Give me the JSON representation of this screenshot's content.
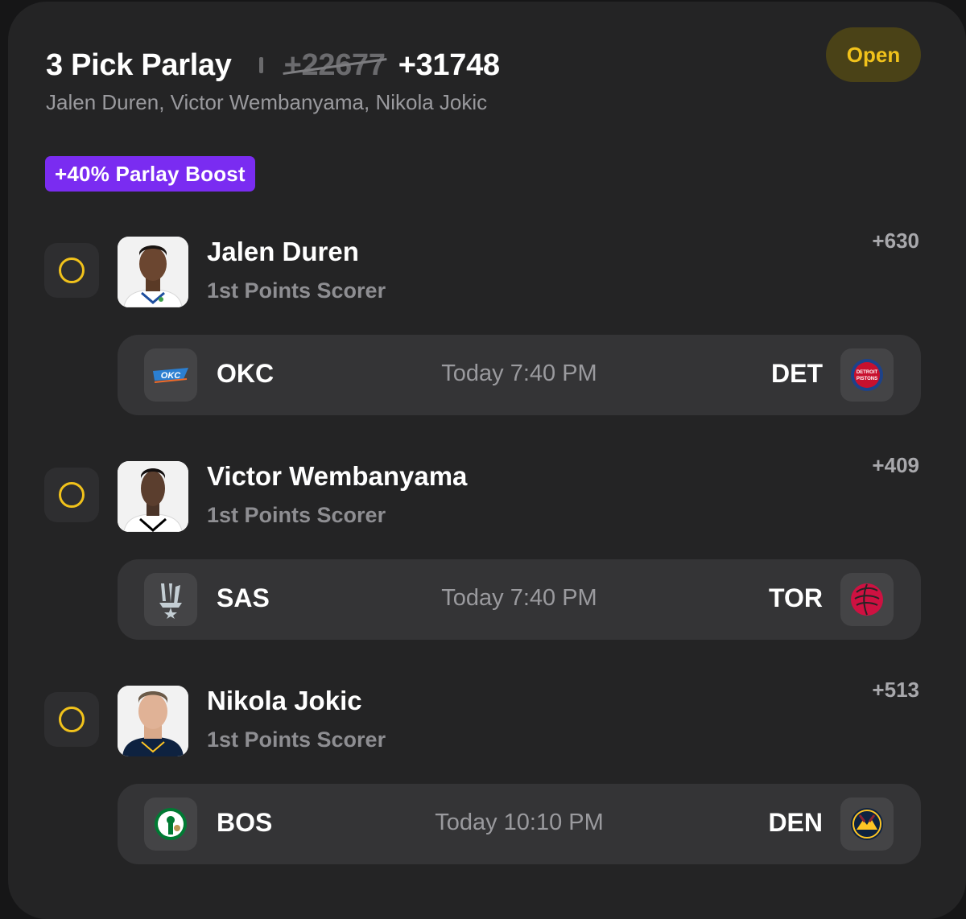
{
  "header": {
    "title": "3 Pick Parlay",
    "old_odds": "+22677",
    "new_odds": "+31748",
    "players_summary": "Jalen Duren, Victor Wembanyama, Nikola Jokic",
    "status": "Open",
    "boost": "+40% Parlay Boost"
  },
  "picks": [
    {
      "player": "Jalen Duren",
      "market": "1st Points Scorer",
      "odds": "+630",
      "game": {
        "away": "OKC",
        "away_icon": "okc-thunder-logo-icon",
        "time": "Today 7:40 PM",
        "home": "DET",
        "home_icon": "detroit-pistons-logo-icon"
      }
    },
    {
      "player": "Victor Wembanyama",
      "market": "1st Points Scorer",
      "odds": "+409",
      "game": {
        "away": "SAS",
        "away_icon": "san-antonio-spurs-logo-icon",
        "time": "Today 7:40 PM",
        "home": "TOR",
        "home_icon": "toronto-raptors-logo-icon"
      }
    },
    {
      "player": "Nikola Jokic",
      "market": "1st Points Scorer",
      "odds": "+513",
      "game": {
        "away": "BOS",
        "away_icon": "boston-celtics-logo-icon",
        "time": "Today 10:10 PM",
        "home": "DEN",
        "home_icon": "denver-nuggets-logo-icon"
      }
    }
  ],
  "colors": {
    "background": "#161617",
    "card": "#242425",
    "accent_yellow": "#f1c21b",
    "boost_purple": "#7a2cf1",
    "game_row": "#343436"
  }
}
